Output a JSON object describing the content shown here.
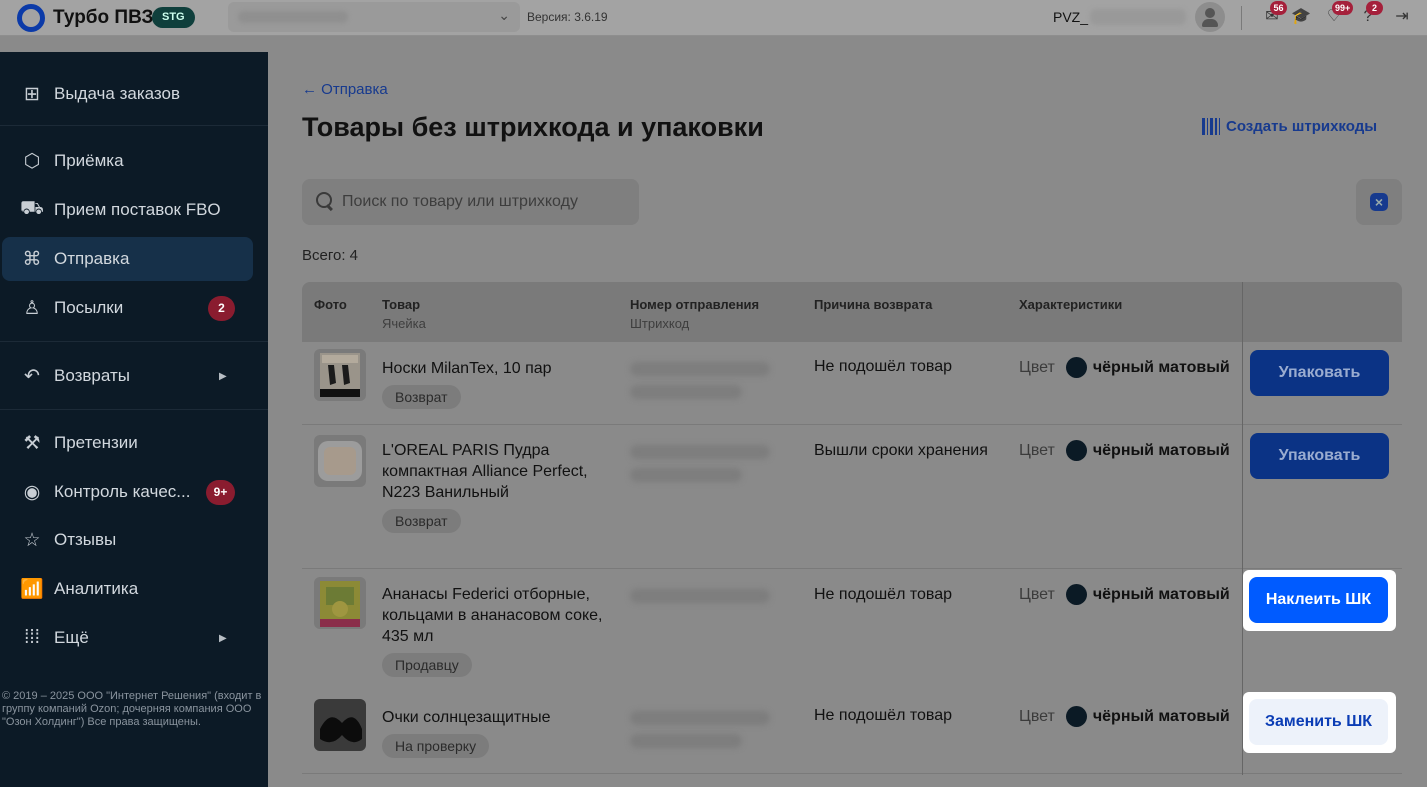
{
  "header": {
    "brand": "Турбо ПВЗ",
    "env_badge": "STG",
    "version": "Версия: 3.6.19",
    "pvz_label": "PVZ_",
    "badges": {
      "messages": "56",
      "notifications": "99+",
      "help": "2"
    }
  },
  "sidebar": {
    "items": [
      {
        "label": "Выдача заказов",
        "icon": "handover-icon"
      },
      {
        "label": "Приёмка",
        "icon": "box-icon"
      },
      {
        "label": "Прием поставок FBO",
        "icon": "truck-icon"
      },
      {
        "label": "Отправка",
        "icon": "dolly-icon"
      },
      {
        "label": "Посылки",
        "icon": "person-icon",
        "badge": "2"
      },
      {
        "label": "Возвраты",
        "icon": "return-icon"
      },
      {
        "label": "Претензии",
        "icon": "gavel-icon"
      },
      {
        "label": "Контроль качес...",
        "icon": "eye-icon",
        "badge": "9+"
      },
      {
        "label": "Отзывы",
        "icon": "review-icon"
      },
      {
        "label": "Аналитика",
        "icon": "analytics-icon"
      },
      {
        "label": "Ещё",
        "icon": "grid-icon"
      }
    ],
    "copyright": "© 2019 – 2025 ООО \"Интернет Решения\" (входит в группу компаний Ozon; дочерняя компания ООО \"Озон Холдинг\") Все права защищены."
  },
  "main": {
    "back_link": "← Отправка",
    "title": "Товары без штрихкода и упаковки",
    "create_barcodes": "Создать штрихкоды",
    "search_placeholder": "Поиск по товару или штрихкоду",
    "total": "Всего: 4"
  },
  "table": {
    "headers": {
      "photo": "Фото",
      "product": "Товар",
      "product_sub": "Ячейка",
      "shipment": "Номер отправления",
      "shipment_sub": "Штрихкод",
      "reason": "Причина возврата",
      "chars": "Характеристики"
    },
    "rows": [
      {
        "name": "Носки MilanTex, 10 пар",
        "tag": "Возврат",
        "reason": "Не подошёл товар",
        "char_label": "Цвет",
        "char_value": "чёрный матовый",
        "action": "Упаковать"
      },
      {
        "name": "L'OREAL PARIS Пудра компактная Alliance Perfect, N223 Ванильный",
        "tag": "Возврат",
        "reason": "Вышли сроки хранения",
        "char_label": "Цвет",
        "char_value": "чёрный матовый",
        "action": "Упаковать"
      },
      {
        "name": "Ананасы Federici отборные, кольцами в ананасовом соке, 435 мл",
        "tag": "Продавцу",
        "reason": "Не подошёл товар",
        "char_label": "Цвет",
        "char_value": "чёрный матовый",
        "action": "Наклеить ШК"
      },
      {
        "name": "Очки солнцезащитные",
        "tag": "На проверку",
        "reason": "Не подошёл товар",
        "char_label": "Цвет",
        "char_value": "чёрный матовый",
        "action": "Заменить ШК"
      }
    ]
  },
  "colors": {
    "accent": "#005bff",
    "sidebar_bg": "#0c1a26",
    "badge": "#8a1c2f"
  }
}
